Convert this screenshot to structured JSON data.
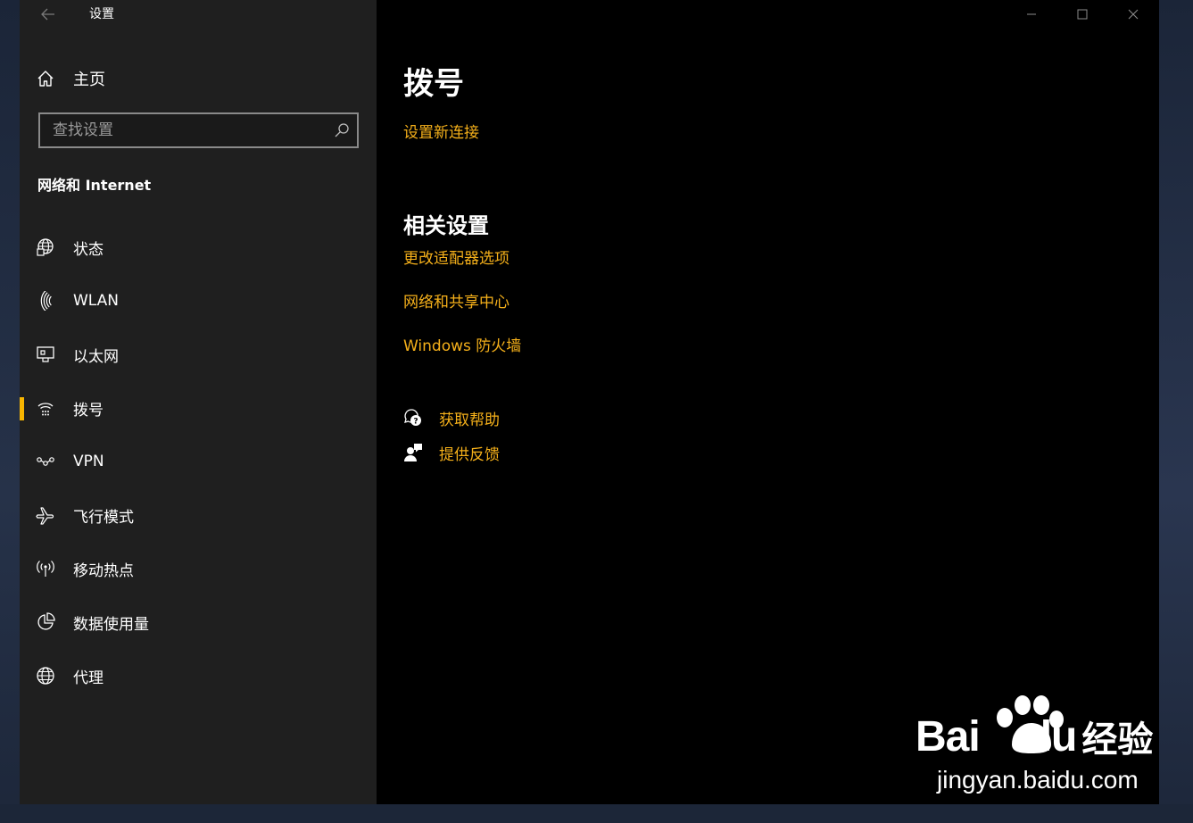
{
  "window": {
    "title": "设置",
    "back_icon": "back-arrow-icon",
    "controls": [
      "minimize-icon",
      "maximize-icon",
      "close-icon"
    ]
  },
  "sidebar": {
    "home": {
      "label": "主页",
      "icon": "home-icon"
    },
    "search": {
      "placeholder": "查找设置",
      "value": "",
      "icon": "search-icon"
    },
    "section_title": "网络和 Internet",
    "items": [
      {
        "label": "状态",
        "icon": "status-globe-icon",
        "active": false
      },
      {
        "label": "WLAN",
        "icon": "wifi-icon",
        "active": false
      },
      {
        "label": "以太网",
        "icon": "ethernet-icon",
        "active": false
      },
      {
        "label": "拨号",
        "icon": "dialup-icon",
        "active": true
      },
      {
        "label": "VPN",
        "icon": "vpn-icon",
        "active": false
      },
      {
        "label": "飞行模式",
        "icon": "airplane-icon",
        "active": false
      },
      {
        "label": "移动热点",
        "icon": "hotspot-icon",
        "active": false
      },
      {
        "label": "数据使用量",
        "icon": "data-usage-icon",
        "active": false
      },
      {
        "label": "代理",
        "icon": "proxy-globe-icon",
        "active": false
      }
    ]
  },
  "main": {
    "title": "拨号",
    "setup_link": "设置新连接",
    "related_title": "相关设置",
    "related_links": [
      "更改适配器选项",
      "网络和共享中心",
      "Windows 防火墙"
    ],
    "help_links": [
      {
        "label": "获取帮助",
        "icon": "help-chat-icon"
      },
      {
        "label": "提供反馈",
        "icon": "feedback-icon"
      }
    ]
  },
  "watermark": {
    "brand_latin": "Bai",
    "brand_latin_2": "du",
    "brand_cn": "经验",
    "url": "jingyan.baidu.com"
  },
  "colors": {
    "accent": "#f5b01a",
    "active_bar": "#f7b500",
    "sidebar_bg": "#1f1f1f",
    "content_bg": "#000000"
  }
}
